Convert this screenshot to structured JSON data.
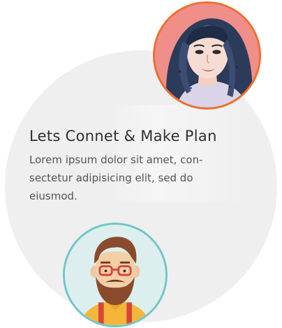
{
  "card": {
    "title": "Lets Connet & Make Plan",
    "description": "Lorem ipsum dolor sit amet, con-\nsectetur adipisicing elit, sed do\neiusmod."
  },
  "avatars": {
    "top_right": {
      "icon": "woman-portrait-illustration",
      "ring_color": "#ee6f2d",
      "bg_color": "#f0908c"
    },
    "bottom_left": {
      "icon": "bearded-man-illustration",
      "ring_color": "#73c5c6",
      "bg_color": "#dcefee"
    }
  },
  "colors": {
    "background_circle": "#efefef",
    "title_text": "#2f2f2f",
    "body_text": "#555555"
  }
}
